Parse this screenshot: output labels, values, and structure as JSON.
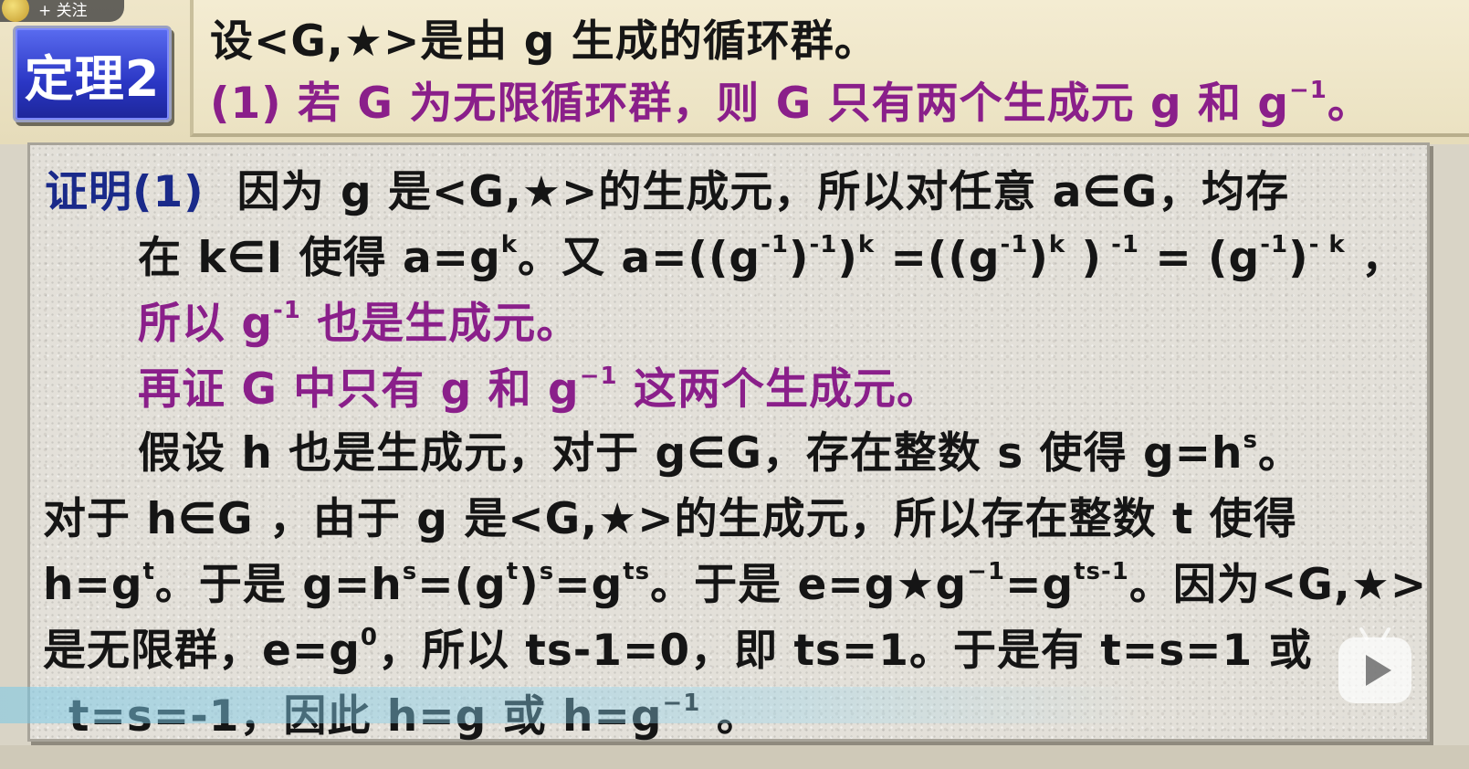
{
  "overlay": {
    "follow_label": "+ 关注",
    "avatar_icon": "avatar-icon",
    "play_icon": "bilibili-play-icon"
  },
  "theorem": {
    "badge": "定理2",
    "statement_line1": "设<G,★>是由 g 生成的循环群。",
    "statement_line2_prefix": "(1) 若 G 为无限循环群，则 G 只有两个生成元 g 和 g",
    "statement_line2_sup": "−1",
    "statement_line2_suffix": "。"
  },
  "proof": {
    "label": "证明(1)",
    "line1_rest": "因为 g 是<G,★>的生成元，所以对任意  a∈G，均存",
    "line2": {
      "t1": "在 k∈I 使得 a=g",
      "s1": "k",
      "t2": "。又 a=((g",
      "s2": "-1",
      "t3": ")",
      "s3": "-1",
      "t4": ")",
      "s4": "k",
      "t5": " =((g",
      "s5": "-1",
      "t6": ")",
      "s6": "k",
      "t7": " )",
      "s7": " -1",
      "t8": " = (g",
      "s8": "-1",
      "t9": ")",
      "s9": "- k",
      "t10": " ，"
    },
    "line3": {
      "t1": "所以 g",
      "s1": "-1",
      "t2": " 也是生成元。"
    },
    "line4": {
      "t1": "再证 G 中只有 g 和 g",
      "s1": "−1",
      "t2": " 这两个生成元。"
    },
    "line5": {
      "t1": "假设 h 也是生成元，对于 g∈G，存在整数 s 使得 g=h",
      "s1": "s",
      "t2": "。"
    },
    "line6": "对于 h∈G ，由于 g 是<G,★>的生成元，所以存在整数 t 使得",
    "line7": {
      "t1": "h=g",
      "s1": "t",
      "t2": "。于是 g=h",
      "s2": "s",
      "t3": "=(g",
      "s3": "t",
      "t4": ")",
      "s4": "s",
      "t5": "=g",
      "s5": "ts",
      "t6": "。于是 e=g★g",
      "s6": "−1",
      "t7": "=g",
      "s7": "ts-1",
      "t8": "。因为<G,★>"
    },
    "line8": {
      "t1": "是无限群，e=g",
      "s1": "0",
      "t2": "，所以 ts-1=0，即 ts=1。于是有  t=s=1 或"
    },
    "line9": {
      "t1": "t=s=-1，因此 h=g 或 h=g",
      "s1": "−1",
      "t2": " 。"
    }
  }
}
